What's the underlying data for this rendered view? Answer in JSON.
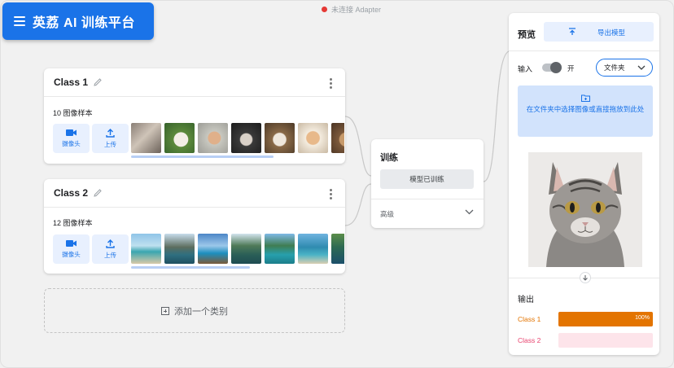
{
  "header": {
    "title": "英荔 AI 训练平台"
  },
  "status": {
    "text": "未连接 Adapter",
    "color": "#e53935"
  },
  "colors": {
    "accent": "#1a73e8",
    "class1": "#e37400",
    "class2": "#e8446f"
  },
  "classes": [
    {
      "name": "Class 1",
      "samples": "10 图像样本",
      "webcam_label": "摄像头",
      "upload_label": "上传",
      "thumb_theme": "cats"
    },
    {
      "name": "Class 2",
      "samples": "12 图像样本",
      "webcam_label": "摄像头",
      "upload_label": "上传",
      "thumb_theme": "landscapes"
    }
  ],
  "add_class": {
    "label": "添加一个类别"
  },
  "training": {
    "title": "训练",
    "button": "模型已训练",
    "advanced": "高级"
  },
  "preview": {
    "title": "预览",
    "export_label": "导出模型",
    "input_label": "输入",
    "toggle_label": "开",
    "toggle_on": true,
    "source_select": "文件夹",
    "drop_text": "在文件夹中选择图像或直接拖放到此处",
    "output_label": "输出",
    "outputs": [
      {
        "label": "Class 1",
        "value": 100,
        "value_text": "100%",
        "color": "#e37400",
        "track": "#fbe3cc"
      },
      {
        "label": "Class 2",
        "value": 0,
        "value_text": "",
        "color": "#e8446f",
        "track": "#fde4ea"
      }
    ]
  }
}
